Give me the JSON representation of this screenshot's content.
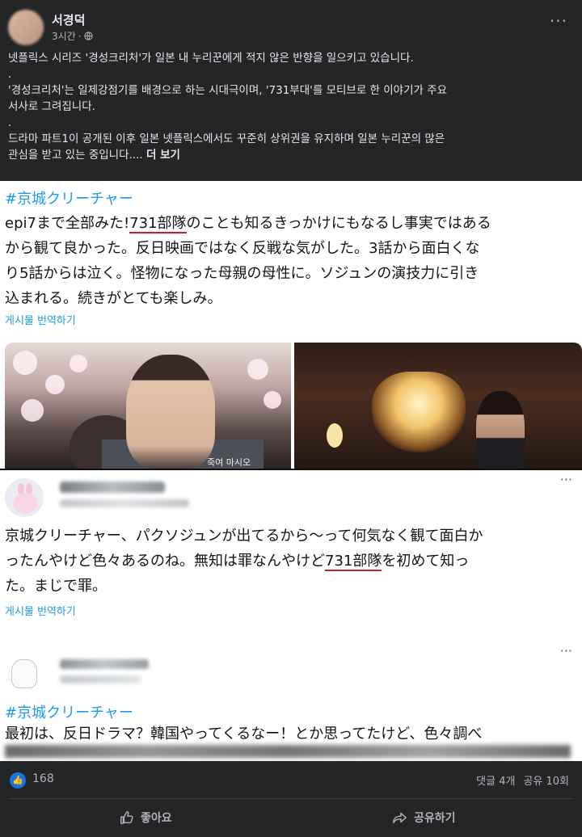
{
  "post": {
    "author": "서경덕",
    "time": "3시간",
    "privacy_icon": "globe-icon",
    "more_icon": "more-dots-icon",
    "lines": [
      "넷플릭스 시리즈 '경성크리처'가 일본 내 누리꾼에게 적지 않은 반향을 일으키고 있습니다.",
      ".",
      "'경성크리처'는 일제강점기를 배경으로 하는 시대극이며, '731부대'를 모티브로 한 이야기가 주요",
      "서사로 그려집니다.",
      ".",
      "드라마 파트1이 공개된 이후 일본 넷플릭스에서도 꾸준히 상위권을 유지하며 일본 누리꾼의 많은",
      "관심을 받고 있는 중입니다...."
    ],
    "see_more": "더 보기"
  },
  "tweet1": {
    "hashtag": "#京城クリーチャー",
    "line1_pre": "epi7まで全部みた!",
    "line1_hl": "731部隊",
    "line1_post": "のことも知るきっかけにもなるし事実ではある",
    "line2": "から観て良かった。反日映画ではなく反戦な気がした。3話から面白くな",
    "line3": "り5話からは泣く。怪物になった母親の母性に。ソジュンの演技力に引き",
    "line4": "込まれる。続きがとても楽しみ。",
    "translate": "게시물 번역하기",
    "photo_caption": "죽여 마시오"
  },
  "tweet2": {
    "line1": "京城クリーチャー、パクソジュンが出てるから〜って何気なく観て面白か",
    "line2_pre": "ったんやけど色々あるのね。無知は罪なんやけど",
    "line2_hl": "731部隊",
    "line2_post": "を初めて知っ",
    "line3": "た。まじで罪。",
    "translate": "게시물 번역하기"
  },
  "tweet3": {
    "hashtag": "#京城クリーチャー",
    "line1": "最初は、反日ドラマ？韓国やってくるなー！とか思ってたけど、色々調べ"
  },
  "footer": {
    "like_count": "168",
    "comments": "댓글 4개",
    "shares": "공유 10회",
    "like_label": "좋아요",
    "share_label": "공유하기"
  }
}
